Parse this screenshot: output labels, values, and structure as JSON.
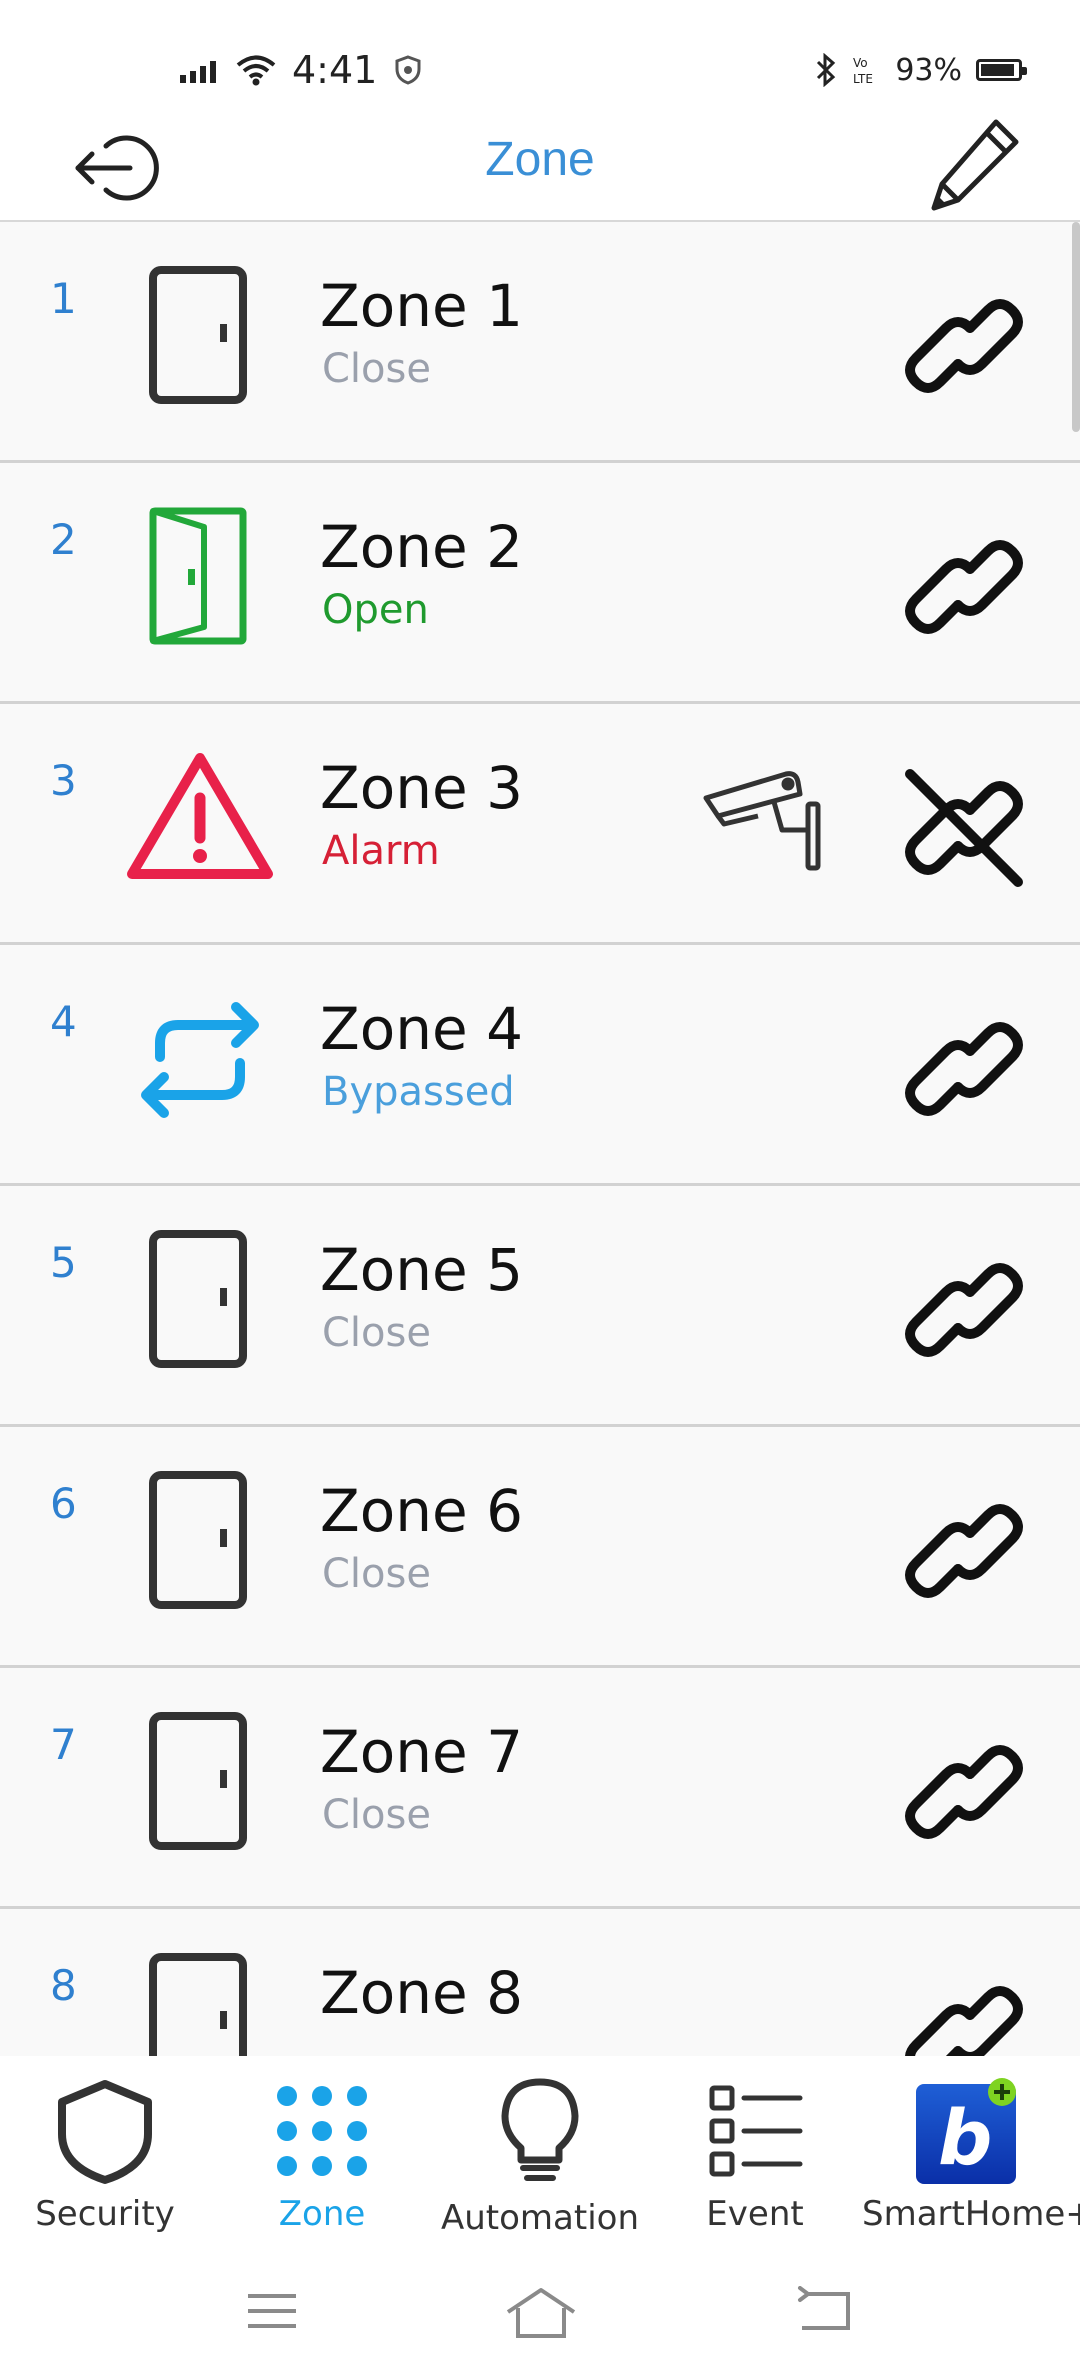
{
  "status_bar": {
    "time": "4:41",
    "battery_text": "93%",
    "battery_level": 0.93,
    "icons": [
      "signal-icon",
      "wifi-icon",
      "vpn-shield-icon",
      "bluetooth-icon",
      "volte-icon",
      "battery-icon"
    ]
  },
  "header": {
    "title": "Zone",
    "back_icon": "logout-arrow-icon",
    "edit_icon": "pencil-icon"
  },
  "colors": {
    "accent": "#3a8fd6",
    "number": "#2f80cf",
    "close": "#9aa0ac",
    "open": "#1f9a2e",
    "alarm": "#d62036",
    "bypassed": "#4a9fdc"
  },
  "zones": [
    {
      "num": "1",
      "name": "Zone 1",
      "state": "Close",
      "status": "close",
      "icon": "door-closed-icon",
      "camera": false,
      "linked": true
    },
    {
      "num": "2",
      "name": "Zone 2",
      "state": "Open",
      "status": "open",
      "icon": "door-open-icon",
      "camera": false,
      "linked": true
    },
    {
      "num": "3",
      "name": "Zone 3",
      "state": "Alarm",
      "status": "alarm",
      "icon": "alarm-warning-icon",
      "camera": true,
      "linked": false
    },
    {
      "num": "4",
      "name": "Zone 4",
      "state": "Bypassed",
      "status": "bypassed",
      "icon": "bypass-arrows-icon",
      "camera": false,
      "linked": true
    },
    {
      "num": "5",
      "name": "Zone 5",
      "state": "Close",
      "status": "close",
      "icon": "door-closed-icon",
      "camera": false,
      "linked": true
    },
    {
      "num": "6",
      "name": "Zone 6",
      "state": "Close",
      "status": "close",
      "icon": "door-closed-icon",
      "camera": false,
      "linked": true
    },
    {
      "num": "7",
      "name": "Zone 7",
      "state": "Close",
      "status": "close",
      "icon": "door-closed-icon",
      "camera": false,
      "linked": true
    },
    {
      "num": "8",
      "name": "Zone 8",
      "state": "",
      "status": "close",
      "icon": "door-closed-icon",
      "camera": false,
      "linked": true
    }
  ],
  "bottom_nav": [
    {
      "label": "Security",
      "icon": "shield-icon",
      "active": false
    },
    {
      "label": "Zone",
      "icon": "grid-dots-icon",
      "active": true
    },
    {
      "label": "Automation",
      "icon": "lightbulb-icon",
      "active": false
    },
    {
      "label": "Event",
      "icon": "list-icon",
      "active": false
    },
    {
      "label": "SmartHome+",
      "icon": "smarthome-app-icon",
      "active": false
    }
  ],
  "system_nav": [
    "menu-icon",
    "home-icon",
    "back-icon"
  ]
}
